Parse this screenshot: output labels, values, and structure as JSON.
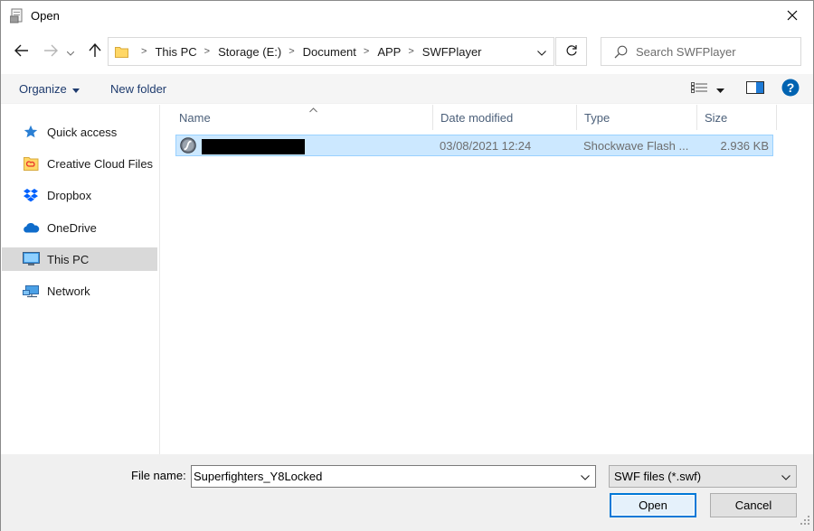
{
  "window": {
    "title": "Open",
    "close_glyph": "✕"
  },
  "nav": {
    "back_icon": "arrow-left-icon",
    "forward_icon": "arrow-right-icon",
    "up_icon": "arrow-up-icon",
    "breadcrumbs": [
      "This PC",
      "Storage (E:)",
      "Document",
      "APP",
      "SWFPlayer"
    ],
    "refresh_icon": "refresh-icon"
  },
  "search": {
    "placeholder": "Search SWFPlayer"
  },
  "toolbar": {
    "organize_label": "Organize",
    "new_folder_label": "New folder"
  },
  "sidebar": {
    "items": [
      {
        "label": "Quick access",
        "icon": "star-icon"
      },
      {
        "label": "Creative Cloud Files",
        "icon": "creative-cloud-folder-icon"
      },
      {
        "label": "Dropbox",
        "icon": "dropbox-icon"
      },
      {
        "label": "OneDrive",
        "icon": "cloud-icon"
      },
      {
        "label": "This PC",
        "icon": "computer-icon",
        "selected": true
      },
      {
        "label": "Network",
        "icon": "network-icon"
      }
    ]
  },
  "file_list": {
    "columns": [
      "Name",
      "Date modified",
      "Type",
      "Size"
    ],
    "rows": [
      {
        "name": "",
        "name_redacted": true,
        "date": "03/08/2021 12:24",
        "type": "Shockwave Flash ...",
        "size": "2.936 KB",
        "selected": true
      }
    ]
  },
  "bottom": {
    "file_name_label": "File name:",
    "file_name_value": "Superfighters_Y8Locked",
    "file_type_value": "SWF files (*.swf)",
    "open_label": "Open",
    "cancel_label": "Cancel"
  },
  "colors": {
    "accent": "#0078d7",
    "selection": "#cce8ff",
    "help": "#0063b1"
  }
}
